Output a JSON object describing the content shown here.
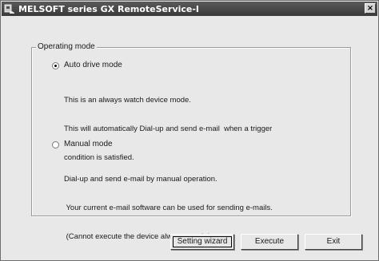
{
  "window": {
    "title": "MELSOFT series GX RemoteService-I",
    "close_label": "×"
  },
  "group": {
    "legend": "Operating mode"
  },
  "auto_mode": {
    "label": "Auto drive mode",
    "checked": true,
    "description": [
      "This is an always watch device mode.",
      "This will automatically Dial-up and send e-mail  when a trigger",
      "condition is satisfied."
    ]
  },
  "manual_mode": {
    "label": "Manual mode",
    "checked": false,
    "description": [
      "Dial-up and send e-mail by manual operation.",
      " Your current e-mail software can be used for sending e-mails.",
      " (Cannot execute the device always watch.)"
    ]
  },
  "buttons": {
    "setting_wizard": "Setting wizard",
    "execute": "Execute",
    "exit": "Exit"
  },
  "icons": {
    "app": "melsoft-app-icon",
    "close": "close-icon"
  }
}
